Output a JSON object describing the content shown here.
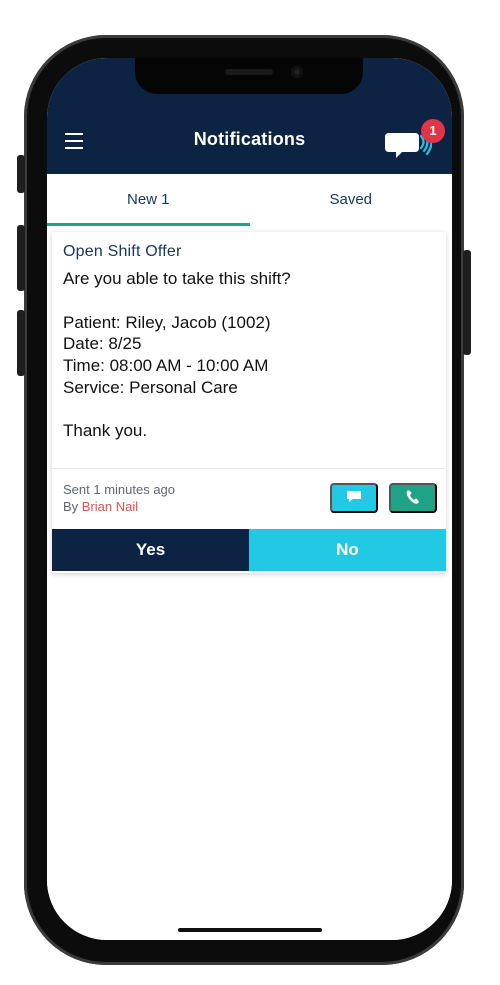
{
  "header": {
    "title": "Notifications",
    "badge_count": "1",
    "menu_icon": "hamburger-menu-icon",
    "chat_icon": "speech-bubble-with-signal-icon",
    "bg": "#0d2344"
  },
  "tabs": [
    {
      "label": "New 1",
      "active": true
    },
    {
      "label": "Saved",
      "active": false
    }
  ],
  "notification": {
    "title": "Open Shift Offer",
    "question": "Are you able to take this shift?",
    "patient": "Patient: Riley, Jacob (1002)",
    "date": "Date: 8/25",
    "time": "Time: 08:00 AM - 10:00 AM",
    "service": "Service: Personal Care",
    "closing": "Thank you.",
    "sent": "Sent 1 minutes ago",
    "by_prefix": "By",
    "author": "Brian Nail",
    "message_icon": "chat-bubble-icon",
    "call_icon": "phone-icon"
  },
  "actions": {
    "yes_label": "Yes",
    "no_label": "No"
  },
  "colors": {
    "accent_teal": "#1aa38f",
    "cyan": "#22c9e4",
    "red": "#e33447",
    "link_red": "#d9534f"
  }
}
